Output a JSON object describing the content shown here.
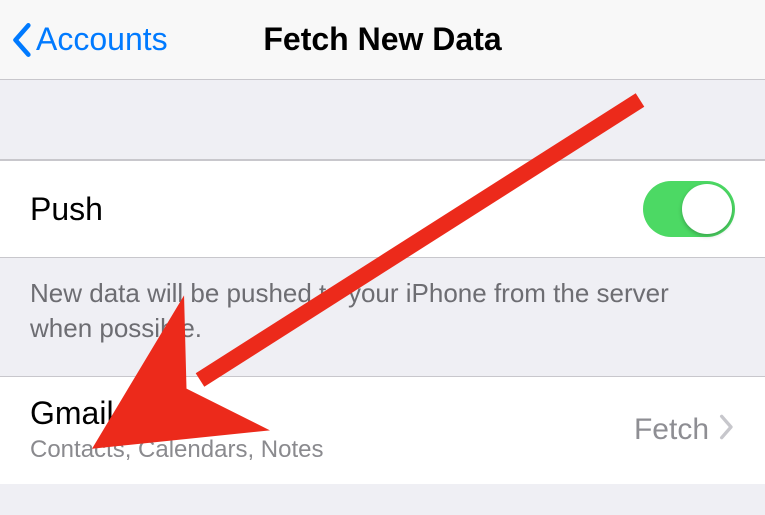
{
  "nav": {
    "back_label": "Accounts",
    "title": "Fetch New Data"
  },
  "push_row": {
    "label": "Push",
    "enabled": true
  },
  "push_note": "New data will be pushed to your iPhone from the server when possible.",
  "account": {
    "name": "Gmail",
    "subtitle": "Contacts, Calendars, Notes",
    "mode": "Fetch"
  }
}
